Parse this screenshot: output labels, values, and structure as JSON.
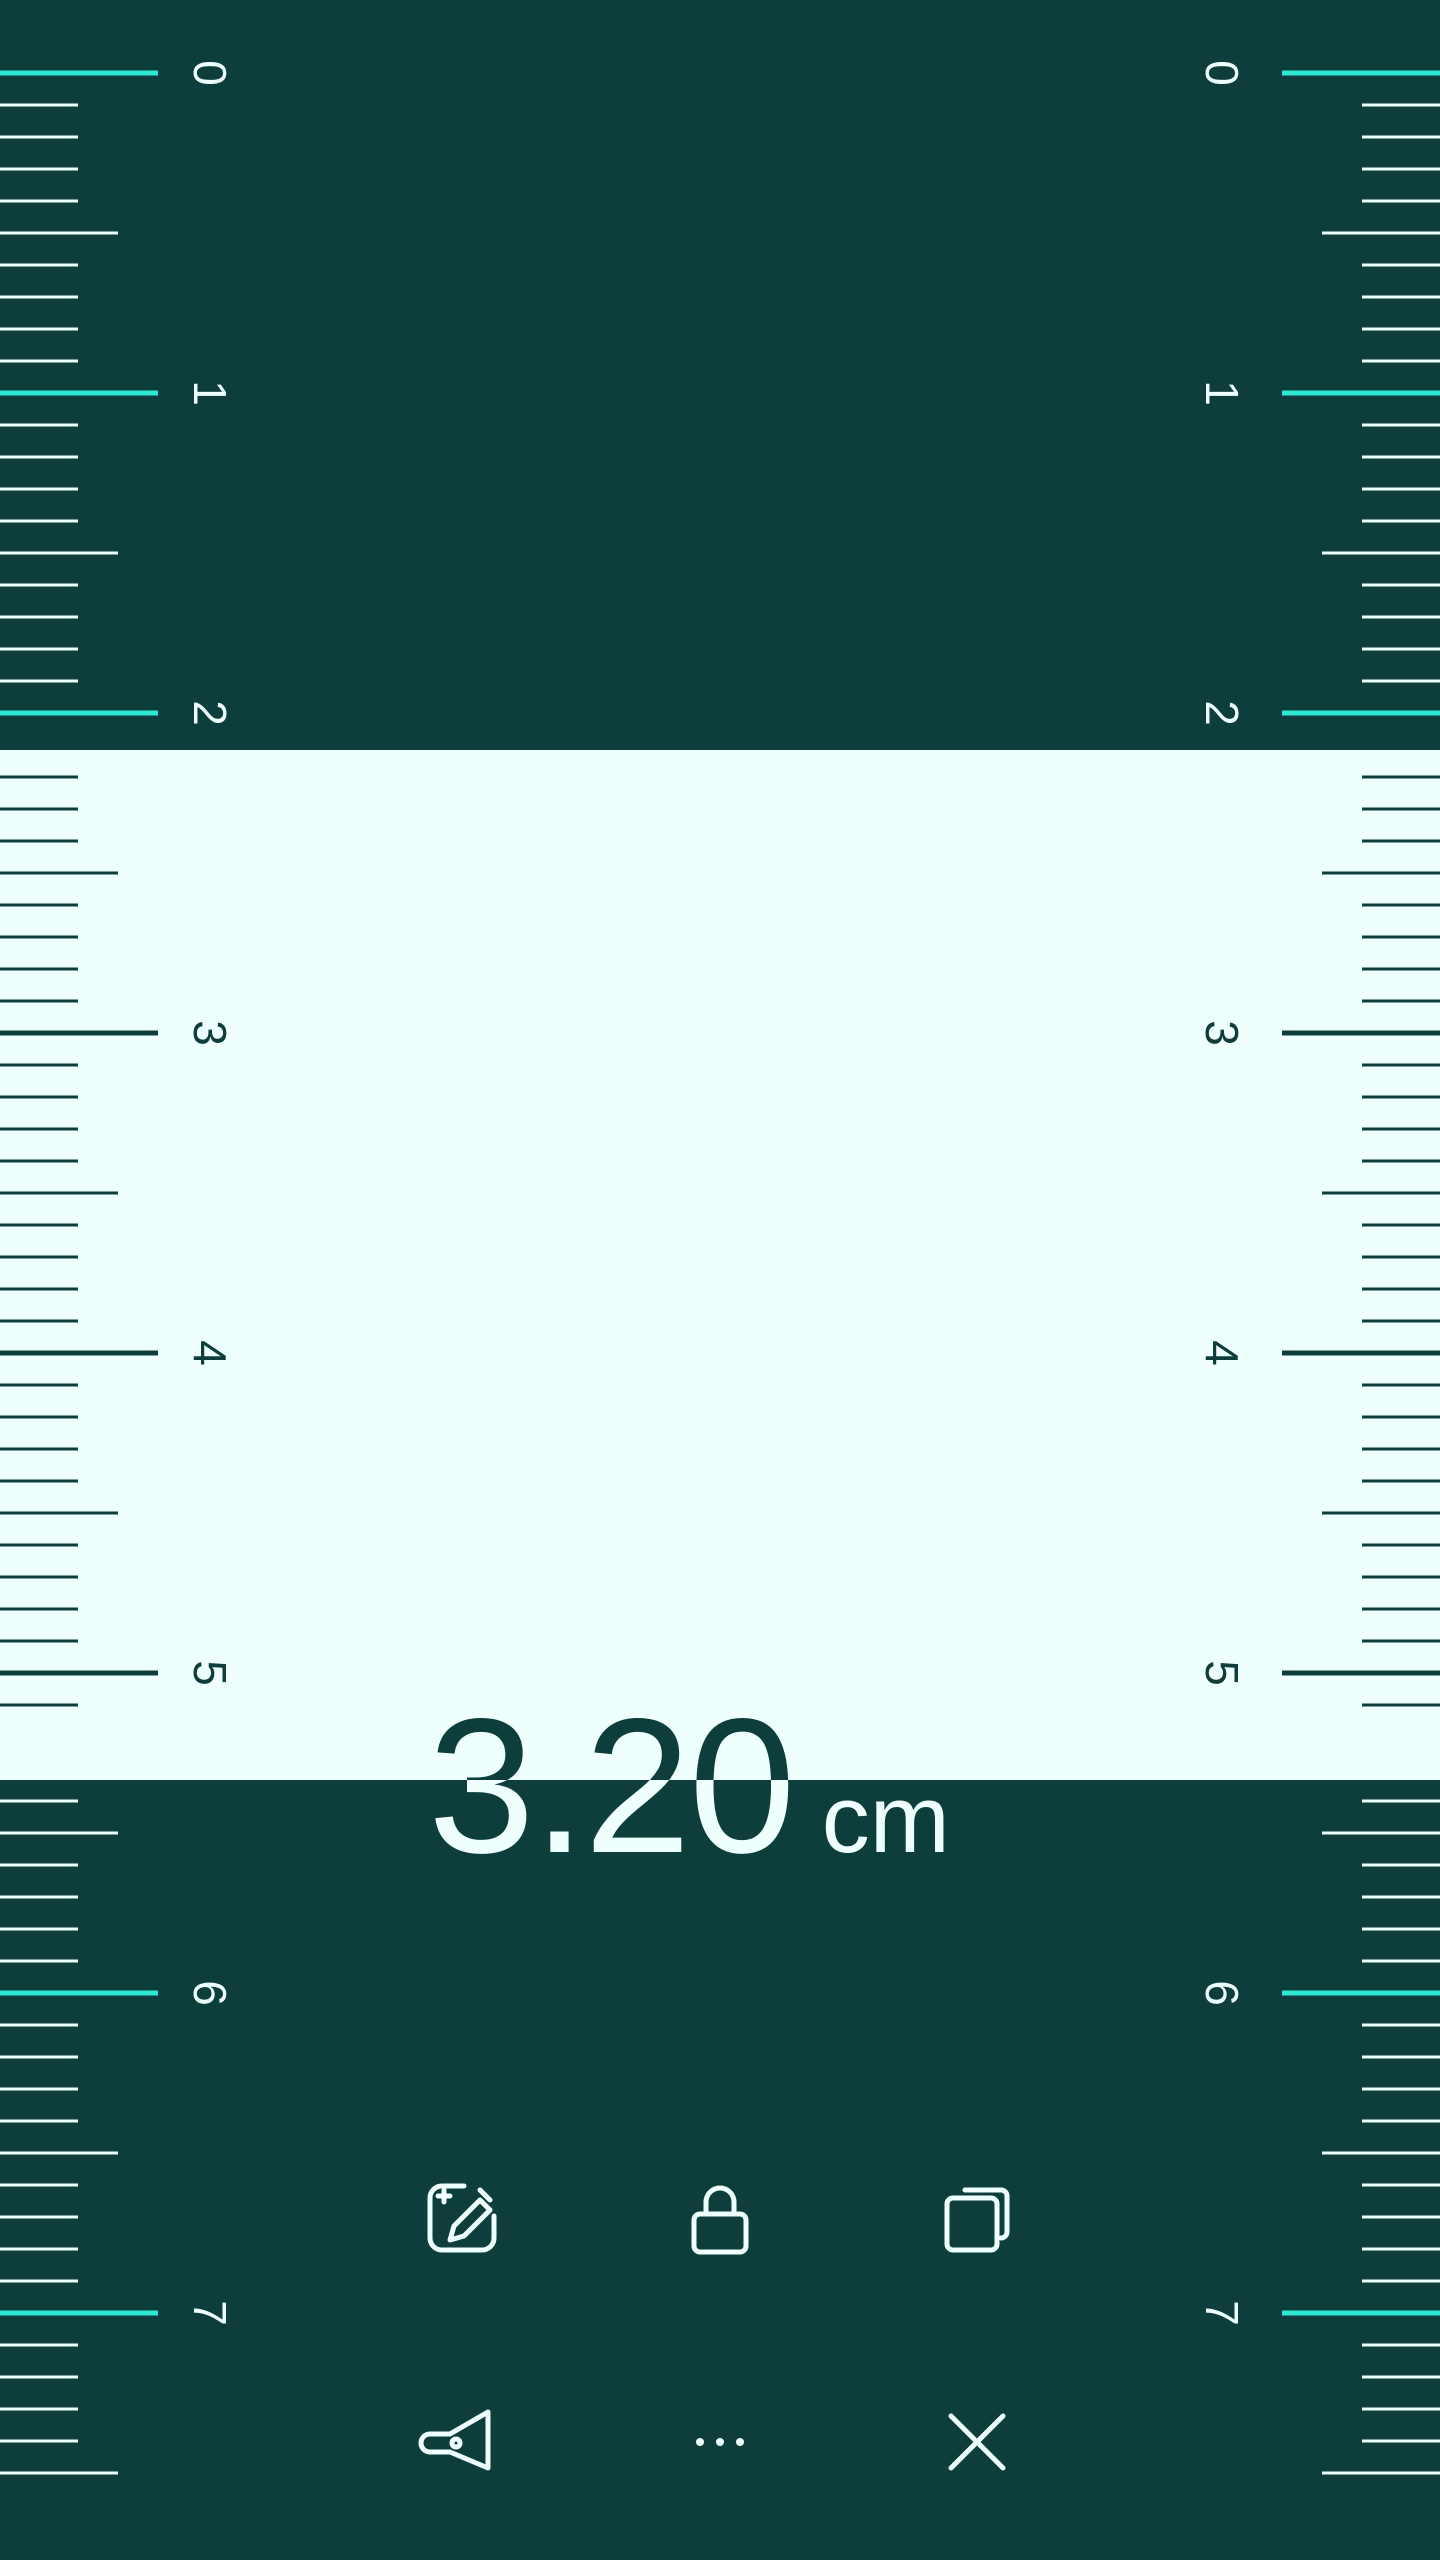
{
  "ruler": {
    "unit_marks": [
      "0",
      "1",
      "2",
      "3",
      "4",
      "5",
      "6",
      "7"
    ],
    "selection_start_cm": 2.0,
    "selection_end_cm": 5.2
  },
  "measurement": {
    "value": "3.20",
    "unit": "cm"
  },
  "toolbar": {
    "row1": [
      "edit-sparkle-icon",
      "lock-icon",
      "copy-icon"
    ],
    "row2": [
      "flashlight-icon",
      "more-icon",
      "close-icon"
    ]
  },
  "colors": {
    "background": "#0e3e3c",
    "selection": "#eefffd",
    "accent_tick": "#2ee8d6",
    "tick_on_dark": "#eefffd",
    "tick_on_light": "#0e3e3c"
  }
}
